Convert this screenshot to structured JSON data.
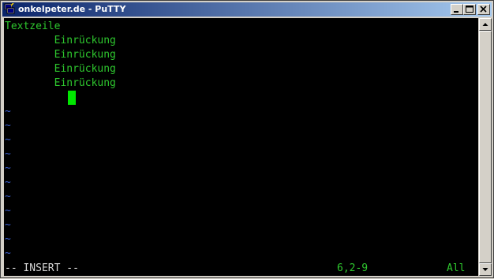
{
  "window": {
    "title": "onkelpeter.de - PuTTY",
    "icons": {
      "app": "putty-icon",
      "minimize": "minimize-icon",
      "maximize": "maximize-icon",
      "close": "close-icon"
    }
  },
  "terminal": {
    "lines": [
      "Textzeile",
      "        Einrückung",
      "        Einrückung",
      "        Einrückung",
      "        Einrückung"
    ],
    "tilde": "~",
    "status": {
      "mode": "-- INSERT --",
      "position": "6,2-9",
      "scroll": "All"
    }
  },
  "colors": {
    "text": "#2ec72e",
    "cursor": "#00e600",
    "tilde": "#3a5fd0",
    "background": "#000000",
    "titlebar_start": "#0a246a",
    "titlebar_end": "#a6caf0"
  }
}
